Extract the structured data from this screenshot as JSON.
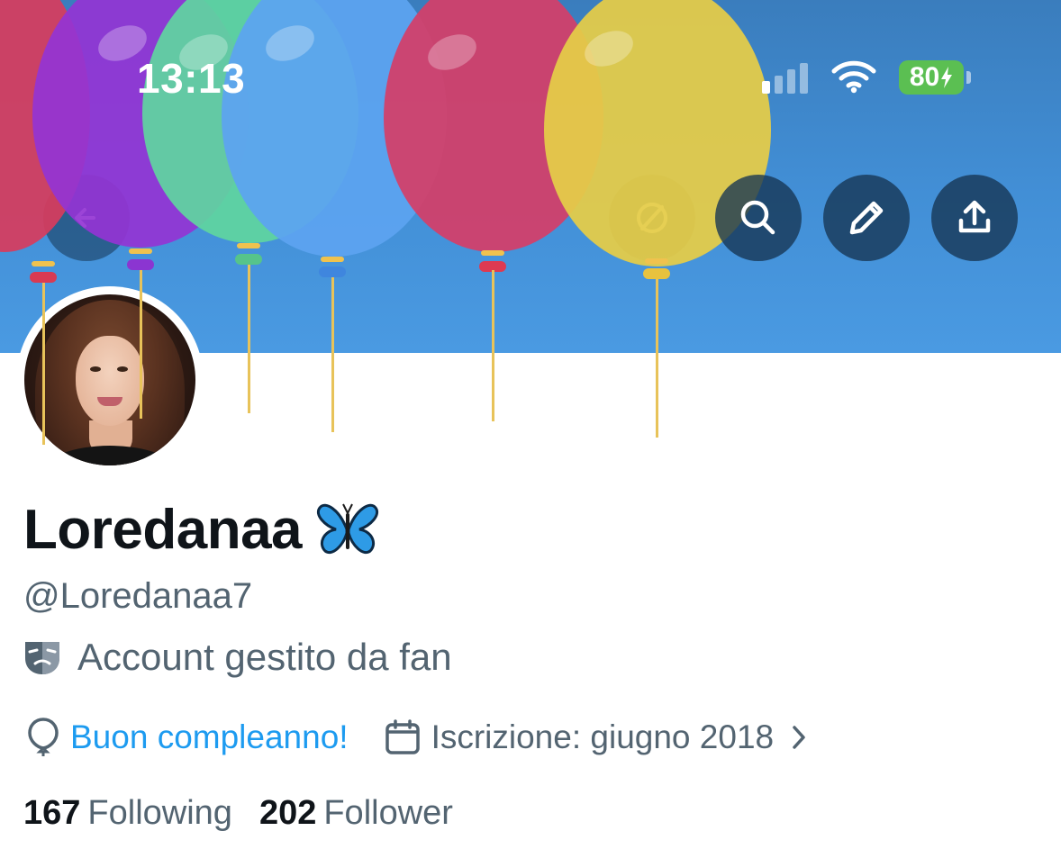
{
  "status_bar": {
    "time": "13:13",
    "battery": "80",
    "signal_bars_active": 1,
    "signal_bars_total": 4
  },
  "nav": {
    "icons": [
      "back-arrow-icon",
      "no-entry-icon",
      "search-icon",
      "pencil-icon",
      "share-icon"
    ]
  },
  "profile": {
    "display_name": "Loredanaa",
    "name_emoji": "🦋",
    "handle": "@Loredanaa7",
    "bio_icon": "theater-masks-icon",
    "bio": "Account gestito da fan",
    "birthday_icon": "balloon-icon",
    "birthday_text": "Buon compleanno!",
    "joined_icon": "calendar-icon",
    "joined_text": "Iscrizione: giugno 2018",
    "joined_chevron": "›",
    "following_count": "167",
    "following_label": "Following",
    "followers_count": "202",
    "followers_label": "Follower"
  },
  "colors": {
    "accent": "#1d9bf0",
    "text_primary": "#0f1419",
    "text_secondary": "#536471",
    "banner_blue": "#428fd6",
    "nav_button": "#163452",
    "battery_green": "#5bbf52"
  }
}
